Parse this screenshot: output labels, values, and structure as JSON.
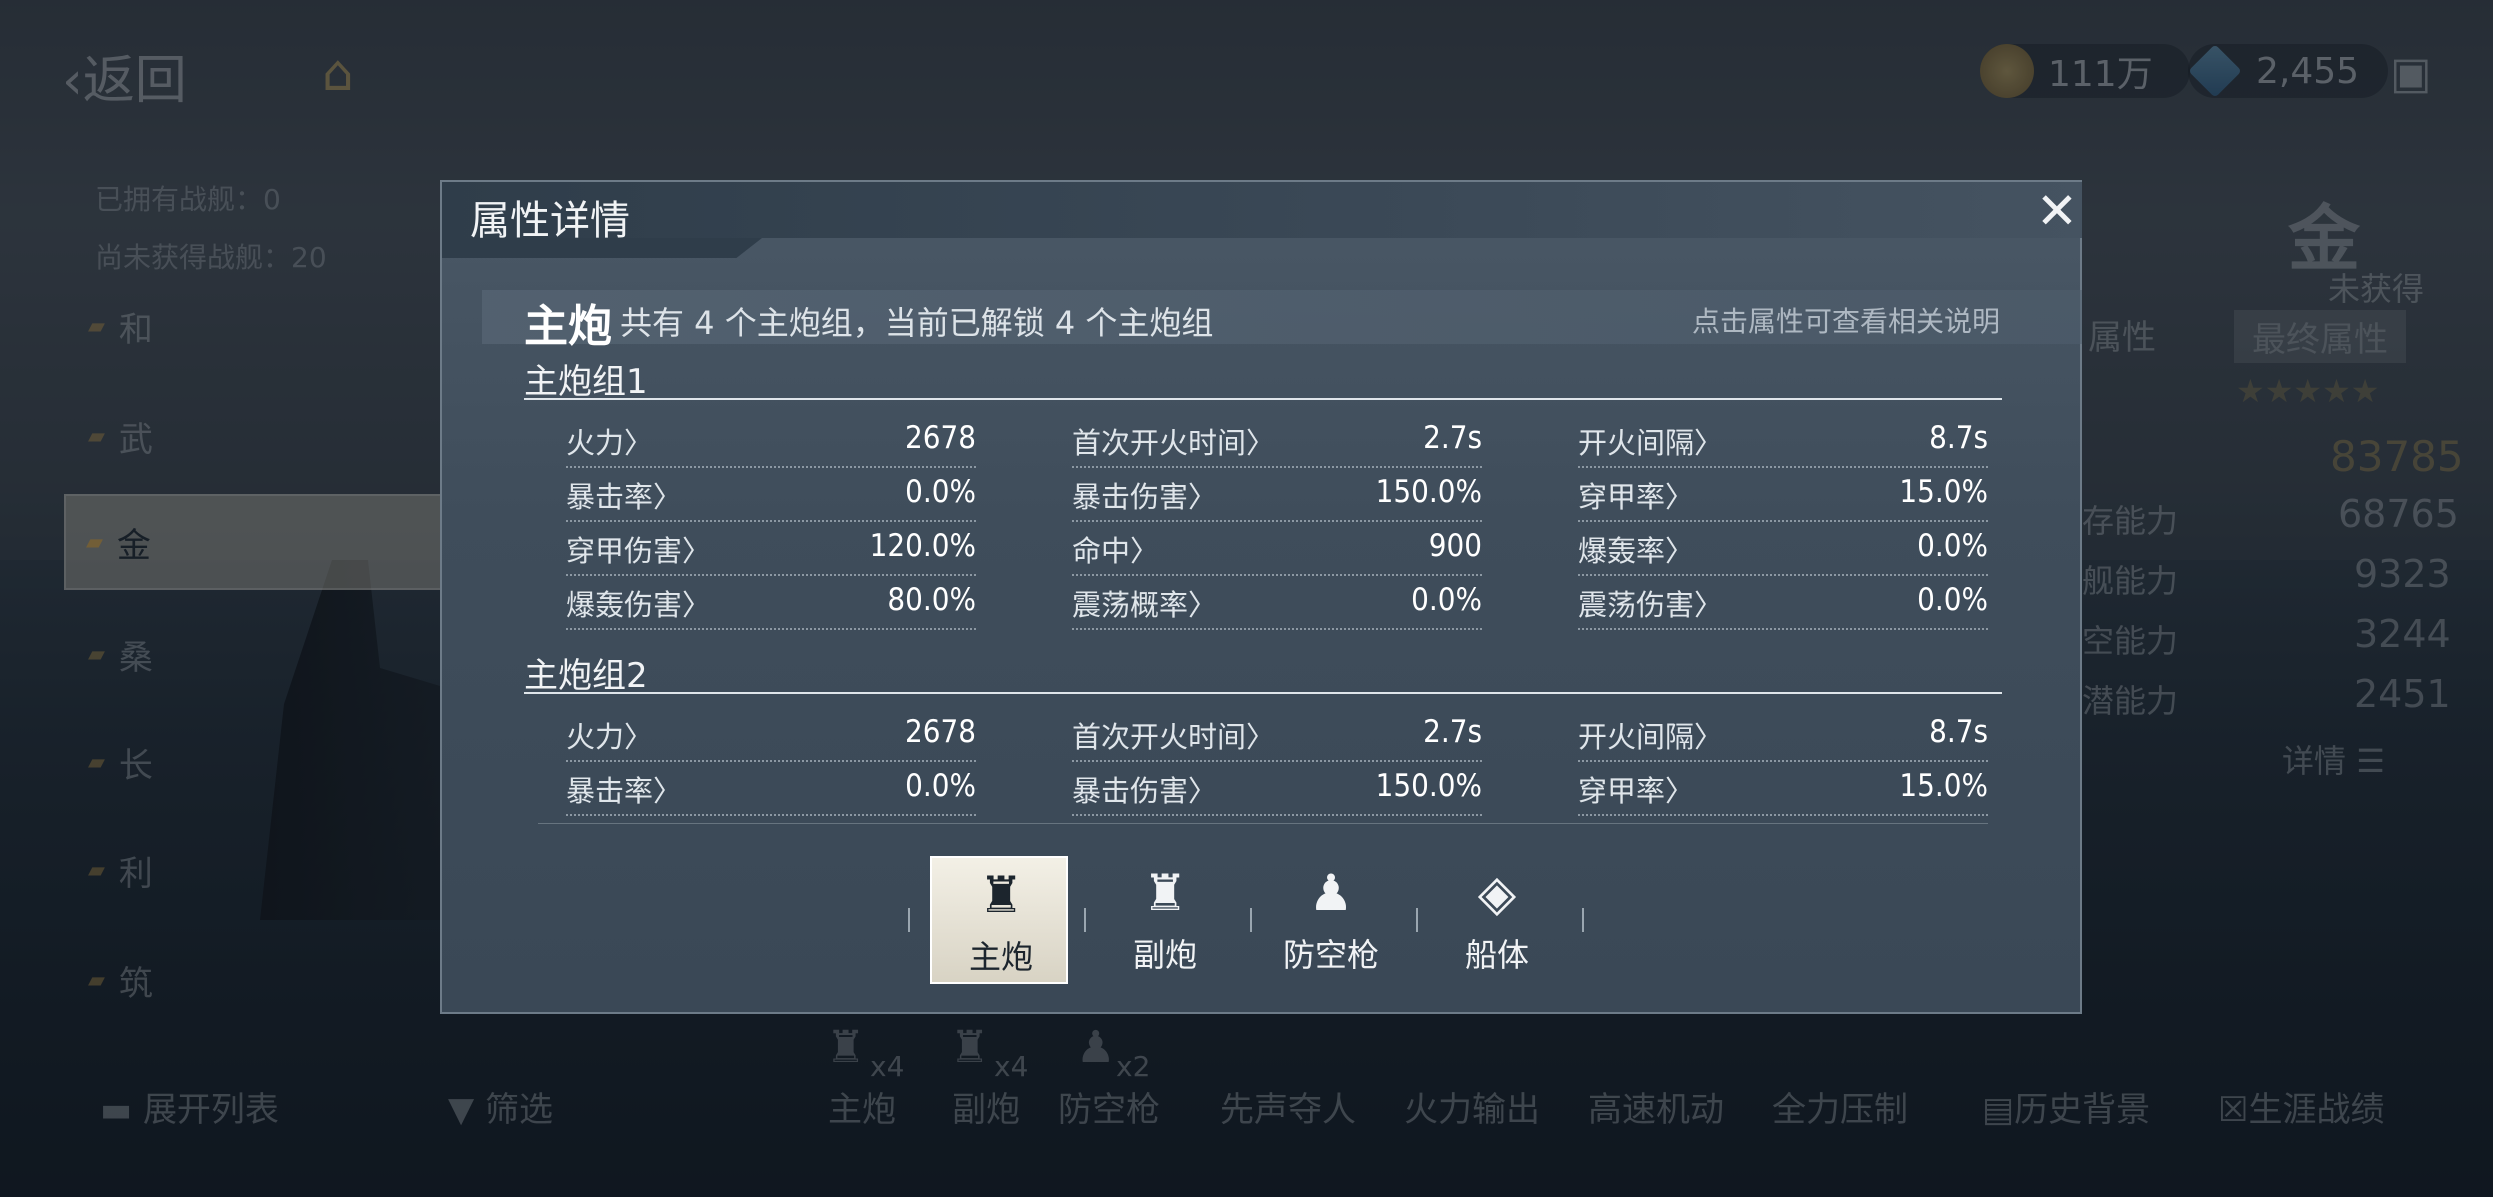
{
  "top": {
    "back_label": "返回",
    "coin": "111万",
    "gem": "2,455"
  },
  "left": {
    "owned": "已拥有战舰：0",
    "not_obtained": "尚未获得战舰：20",
    "ships": [
      "和",
      "武",
      "金",
      "桑",
      "长",
      "利",
      "筑"
    ]
  },
  "right": {
    "ship_char": "金",
    "status": "未获得",
    "tab_base": "属性",
    "tab_final": "最终属性",
    "stars": "★★★★★",
    "total": "83785",
    "rows": [
      {
        "label": "存能力",
        "value": "68765"
      },
      {
        "label": "舰能力",
        "value": "9323"
      },
      {
        "label": "空能力",
        "value": "3244"
      },
      {
        "label": "潜能力",
        "value": "2451"
      }
    ],
    "details": "详情"
  },
  "bottom": {
    "expand": "展开列表",
    "filter": "筛选",
    "weapons": [
      {
        "label": "主炮",
        "count": "x4"
      },
      {
        "label": "副炮",
        "count": "x4"
      },
      {
        "label": "防空枪",
        "count": "x2"
      }
    ],
    "skills": [
      "先声夺人",
      "火力输出",
      "高速机动",
      "全力压制"
    ],
    "history": "历史背景",
    "career": "生涯战绩"
  },
  "modal": {
    "title": "属性详情",
    "section_title": "主炮",
    "section_desc": "共有 4 个主炮组，当前已解锁 4 个主炮组",
    "hint": "点击属性可查看相关说明",
    "groups": [
      {
        "title": "主炮组1",
        "stats": [
          {
            "name": "火力〉",
            "value": "2678"
          },
          {
            "name": "首次开火时间〉",
            "value": "2.7s"
          },
          {
            "name": "开火间隔〉",
            "value": "8.7s"
          },
          {
            "name": "暴击率〉",
            "value": "0.0%"
          },
          {
            "name": "暴击伤害〉",
            "value": "150.0%"
          },
          {
            "name": "穿甲率〉",
            "value": "15.0%"
          },
          {
            "name": "穿甲伤害〉",
            "value": "120.0%"
          },
          {
            "name": "命中〉",
            "value": "900"
          },
          {
            "name": "爆轰率〉",
            "value": "0.0%"
          },
          {
            "name": "爆轰伤害〉",
            "value": "80.0%"
          },
          {
            "name": "震荡概率〉",
            "value": "0.0%"
          },
          {
            "name": "震荡伤害〉",
            "value": "0.0%"
          }
        ]
      },
      {
        "title": "主炮组2",
        "stats": [
          {
            "name": "火力〉",
            "value": "2678"
          },
          {
            "name": "首次开火时间〉",
            "value": "2.7s"
          },
          {
            "name": "开火间隔〉",
            "value": "8.7s"
          },
          {
            "name": "暴击率〉",
            "value": "0.0%"
          },
          {
            "name": "暴击伤害〉",
            "value": "150.0%"
          },
          {
            "name": "穿甲率〉",
            "value": "15.0%"
          }
        ]
      }
    ],
    "tabs": [
      {
        "label": "主炮",
        "icon": "main-gun-icon",
        "active": true
      },
      {
        "label": "副炮",
        "icon": "secondary-gun-icon",
        "active": false
      },
      {
        "label": "防空枪",
        "icon": "aa-gun-icon",
        "active": false
      },
      {
        "label": "船体",
        "icon": "hull-icon",
        "active": false
      }
    ]
  }
}
